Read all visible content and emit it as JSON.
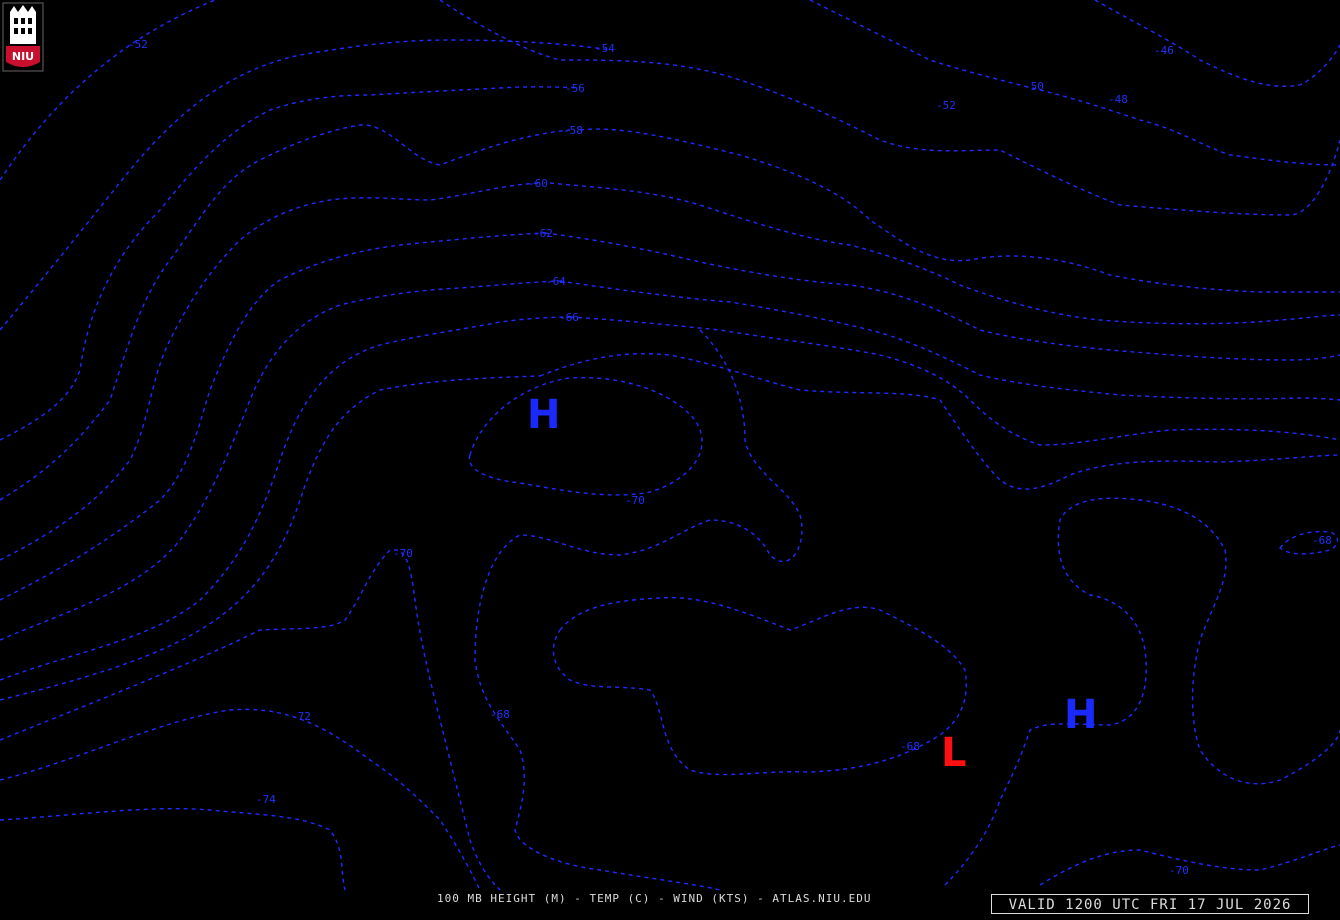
{
  "logo": {
    "text": "NIU",
    "colors": {
      "shield": "#c8102e",
      "tower": "#ffffff"
    }
  },
  "caption": "100 MB HEIGHT (M) - TEMP (C) - WIND (KTS) - ATLAS.NIU.EDU",
  "valid_time": "VALID 1200 UTC FRI 17 JUL 2026",
  "colors": {
    "contour": "#1f2bff",
    "high": "#1a2aff",
    "low": "#ff1010",
    "background": "#000000"
  },
  "centers": {
    "high_1": "H",
    "high_2": "H",
    "low_1": "L"
  },
  "contour_labels": {
    "c1": "-52",
    "c2": "-54",
    "c3": "-56",
    "c4": "-58",
    "c5": "-60",
    "c6": "-62",
    "c7": "-64",
    "c8": "-66",
    "c9": "-70",
    "c10": "-70",
    "c11": "-72",
    "c12": "-74",
    "c13": "-68",
    "c14": "-68",
    "c15": "-68",
    "c16": "-70",
    "c17": "-46",
    "c18": "-48",
    "c19": "-50",
    "c20": "-52"
  }
}
